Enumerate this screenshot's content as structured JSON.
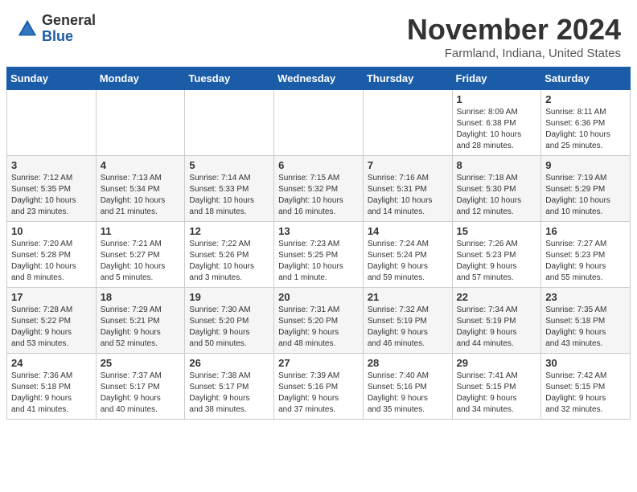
{
  "header": {
    "logo_line1": "General",
    "logo_line2": "Blue",
    "month": "November 2024",
    "location": "Farmland, Indiana, United States"
  },
  "days_of_week": [
    "Sunday",
    "Monday",
    "Tuesday",
    "Wednesday",
    "Thursday",
    "Friday",
    "Saturday"
  ],
  "weeks": [
    [
      {
        "day": "",
        "info": ""
      },
      {
        "day": "",
        "info": ""
      },
      {
        "day": "",
        "info": ""
      },
      {
        "day": "",
        "info": ""
      },
      {
        "day": "",
        "info": ""
      },
      {
        "day": "1",
        "info": "Sunrise: 8:09 AM\nSunset: 6:38 PM\nDaylight: 10 hours\nand 28 minutes."
      },
      {
        "day": "2",
        "info": "Sunrise: 8:11 AM\nSunset: 6:36 PM\nDaylight: 10 hours\nand 25 minutes."
      }
    ],
    [
      {
        "day": "3",
        "info": "Sunrise: 7:12 AM\nSunset: 5:35 PM\nDaylight: 10 hours\nand 23 minutes."
      },
      {
        "day": "4",
        "info": "Sunrise: 7:13 AM\nSunset: 5:34 PM\nDaylight: 10 hours\nand 21 minutes."
      },
      {
        "day": "5",
        "info": "Sunrise: 7:14 AM\nSunset: 5:33 PM\nDaylight: 10 hours\nand 18 minutes."
      },
      {
        "day": "6",
        "info": "Sunrise: 7:15 AM\nSunset: 5:32 PM\nDaylight: 10 hours\nand 16 minutes."
      },
      {
        "day": "7",
        "info": "Sunrise: 7:16 AM\nSunset: 5:31 PM\nDaylight: 10 hours\nand 14 minutes."
      },
      {
        "day": "8",
        "info": "Sunrise: 7:18 AM\nSunset: 5:30 PM\nDaylight: 10 hours\nand 12 minutes."
      },
      {
        "day": "9",
        "info": "Sunrise: 7:19 AM\nSunset: 5:29 PM\nDaylight: 10 hours\nand 10 minutes."
      }
    ],
    [
      {
        "day": "10",
        "info": "Sunrise: 7:20 AM\nSunset: 5:28 PM\nDaylight: 10 hours\nand 8 minutes."
      },
      {
        "day": "11",
        "info": "Sunrise: 7:21 AM\nSunset: 5:27 PM\nDaylight: 10 hours\nand 5 minutes."
      },
      {
        "day": "12",
        "info": "Sunrise: 7:22 AM\nSunset: 5:26 PM\nDaylight: 10 hours\nand 3 minutes."
      },
      {
        "day": "13",
        "info": "Sunrise: 7:23 AM\nSunset: 5:25 PM\nDaylight: 10 hours\nand 1 minute."
      },
      {
        "day": "14",
        "info": "Sunrise: 7:24 AM\nSunset: 5:24 PM\nDaylight: 9 hours\nand 59 minutes."
      },
      {
        "day": "15",
        "info": "Sunrise: 7:26 AM\nSunset: 5:23 PM\nDaylight: 9 hours\nand 57 minutes."
      },
      {
        "day": "16",
        "info": "Sunrise: 7:27 AM\nSunset: 5:23 PM\nDaylight: 9 hours\nand 55 minutes."
      }
    ],
    [
      {
        "day": "17",
        "info": "Sunrise: 7:28 AM\nSunset: 5:22 PM\nDaylight: 9 hours\nand 53 minutes."
      },
      {
        "day": "18",
        "info": "Sunrise: 7:29 AM\nSunset: 5:21 PM\nDaylight: 9 hours\nand 52 minutes."
      },
      {
        "day": "19",
        "info": "Sunrise: 7:30 AM\nSunset: 5:20 PM\nDaylight: 9 hours\nand 50 minutes."
      },
      {
        "day": "20",
        "info": "Sunrise: 7:31 AM\nSunset: 5:20 PM\nDaylight: 9 hours\nand 48 minutes."
      },
      {
        "day": "21",
        "info": "Sunrise: 7:32 AM\nSunset: 5:19 PM\nDaylight: 9 hours\nand 46 minutes."
      },
      {
        "day": "22",
        "info": "Sunrise: 7:34 AM\nSunset: 5:19 PM\nDaylight: 9 hours\nand 44 minutes."
      },
      {
        "day": "23",
        "info": "Sunrise: 7:35 AM\nSunset: 5:18 PM\nDaylight: 9 hours\nand 43 minutes."
      }
    ],
    [
      {
        "day": "24",
        "info": "Sunrise: 7:36 AM\nSunset: 5:18 PM\nDaylight: 9 hours\nand 41 minutes."
      },
      {
        "day": "25",
        "info": "Sunrise: 7:37 AM\nSunset: 5:17 PM\nDaylight: 9 hours\nand 40 minutes."
      },
      {
        "day": "26",
        "info": "Sunrise: 7:38 AM\nSunset: 5:17 PM\nDaylight: 9 hours\nand 38 minutes."
      },
      {
        "day": "27",
        "info": "Sunrise: 7:39 AM\nSunset: 5:16 PM\nDaylight: 9 hours\nand 37 minutes."
      },
      {
        "day": "28",
        "info": "Sunrise: 7:40 AM\nSunset: 5:16 PM\nDaylight: 9 hours\nand 35 minutes."
      },
      {
        "day": "29",
        "info": "Sunrise: 7:41 AM\nSunset: 5:15 PM\nDaylight: 9 hours\nand 34 minutes."
      },
      {
        "day": "30",
        "info": "Sunrise: 7:42 AM\nSunset: 5:15 PM\nDaylight: 9 hours\nand 32 minutes."
      }
    ]
  ]
}
